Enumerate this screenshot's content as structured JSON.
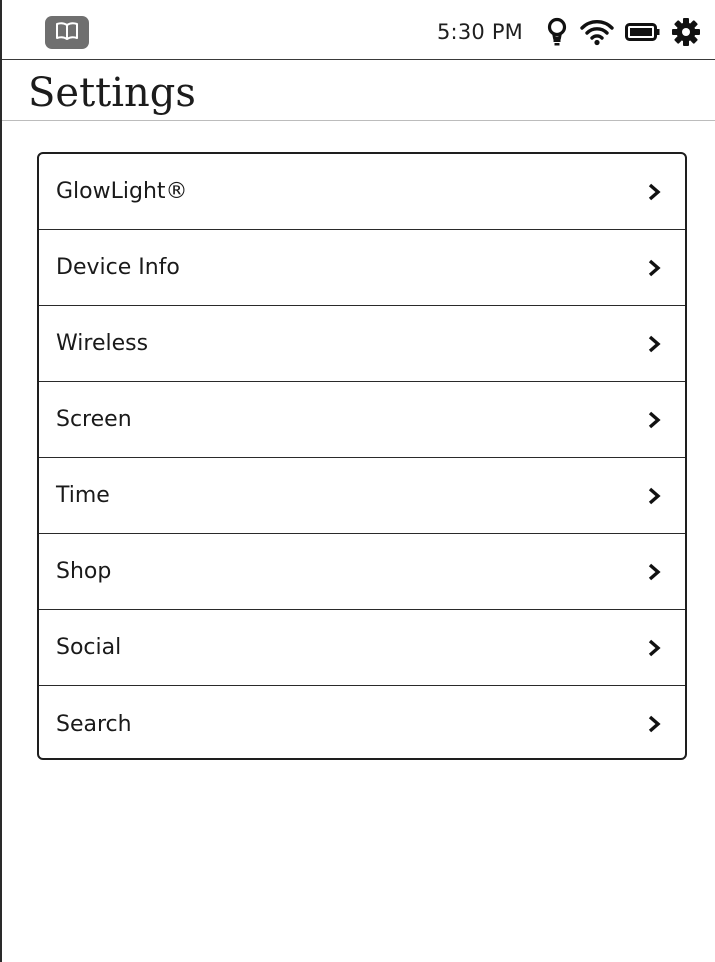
{
  "status_bar": {
    "library_icon": "open-book-icon",
    "time": "5:30 PM",
    "icons": [
      "glowlight-bulb-icon",
      "wifi-icon",
      "battery-icon",
      "gear-icon"
    ]
  },
  "header": {
    "title": "Settings"
  },
  "settings": {
    "items": [
      {
        "label": "GlowLight®",
        "icon": "chevron-right-icon"
      },
      {
        "label": "Device Info",
        "icon": "chevron-right-icon"
      },
      {
        "label": "Wireless",
        "icon": "chevron-right-icon"
      },
      {
        "label": "Screen",
        "icon": "chevron-right-icon"
      },
      {
        "label": "Time",
        "icon": "chevron-right-icon"
      },
      {
        "label": "Shop",
        "icon": "chevron-right-icon"
      },
      {
        "label": "Social",
        "icon": "chevron-right-icon"
      },
      {
        "label": "Search",
        "icon": "chevron-right-icon"
      }
    ]
  },
  "colors": {
    "library_button": "#6f6f6f",
    "text": "#1a1a1a",
    "border": "#1e1e1e"
  }
}
